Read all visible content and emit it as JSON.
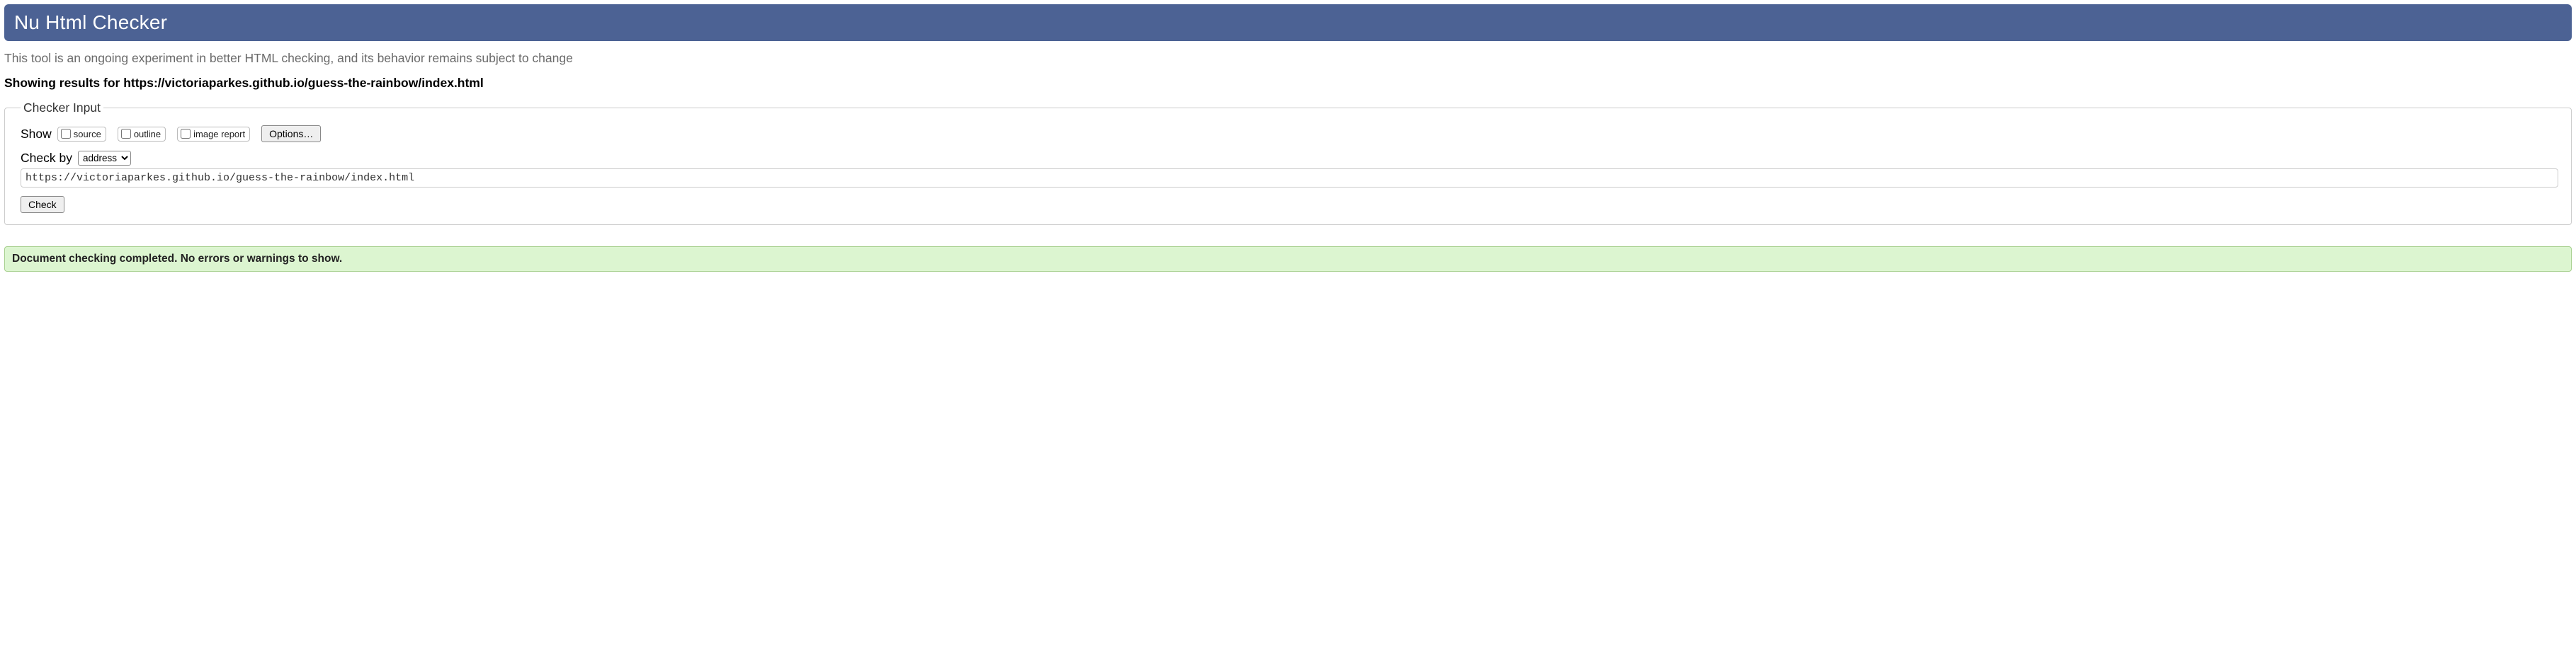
{
  "header": {
    "title": "Nu Html Checker"
  },
  "intro": "This tool is an ongoing experiment in better HTML checking, and its behavior remains subject to change",
  "results_heading": "Showing results for https://victoriaparkes.github.io/guess-the-rainbow/index.html",
  "checker_input": {
    "legend": "Checker Input",
    "show_label": "Show",
    "checkboxes": {
      "source": "source",
      "outline": "outline",
      "image_report": "image report"
    },
    "options_button": "Options…",
    "check_by_label": "Check by",
    "check_by_selected": "address",
    "url_value": "https://victoriaparkes.github.io/guess-the-rainbow/index.html",
    "check_button": "Check"
  },
  "result_message": "Document checking completed. No errors or warnings to show."
}
